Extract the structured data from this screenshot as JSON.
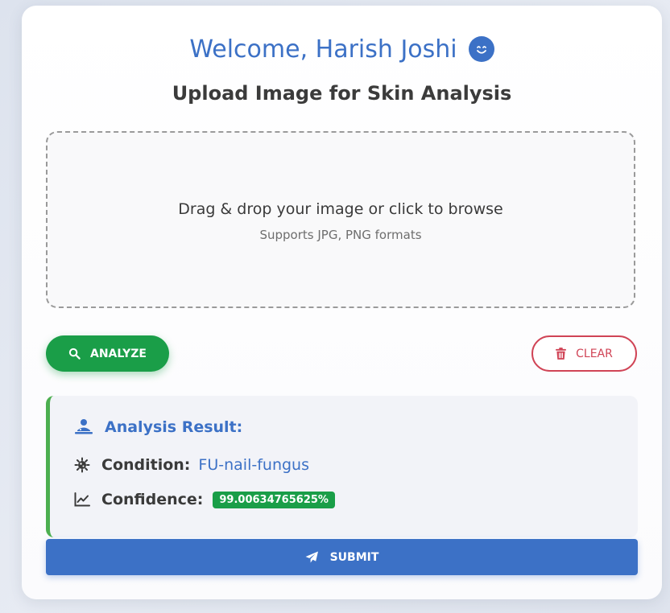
{
  "header": {
    "welcome": "Welcome, Harish Joshi",
    "welcome_icon": "smile-emoji-icon",
    "subtitle": "Upload Image for Skin Analysis"
  },
  "upload": {
    "main_text": "Drag & drop your image or click to browse",
    "sub_text": "Supports JPG, PNG formats"
  },
  "actions": {
    "analyze_label": "ANALYZE",
    "analyze_icon": "search-icon",
    "clear_label": "CLEAR",
    "clear_icon": "trash-icon",
    "submit_label": "SUBMIT",
    "submit_icon": "paper-plane-icon"
  },
  "result": {
    "title": "Analysis Result:",
    "title_icon": "user-doctor-icon",
    "condition_label": "Condition:",
    "condition_value": "FU-nail-fungus",
    "condition_icon": "virus-icon",
    "confidence_label": "Confidence:",
    "confidence_value": "99.00634765625%",
    "confidence_icon": "chart-line-icon"
  },
  "colors": {
    "primary_blue": "#3c71c6",
    "success_green": "#1a9e48",
    "danger_red": "#d04456",
    "result_border": "#4caf50"
  }
}
